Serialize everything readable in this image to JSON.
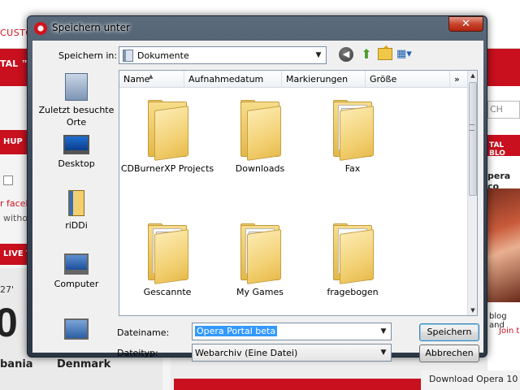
{
  "background": {
    "custo_text": "CUSTO",
    "portal_text": "TAL ™",
    "hup_text": "HUP",
    "live_text": "LIVE T",
    "facebook_text": "r faceb",
    "without_text": "withou",
    "minute_text": "27'",
    "score_digit": "0",
    "team_left": "bania",
    "team_right": "Denmark",
    "search_text": "CH",
    "right_banner_text": "TAL BLO",
    "opera_co_text": "pera co",
    "blog_text": "blog and",
    "join_text": "Join t",
    "download_text": "Download Opera 10"
  },
  "dialog": {
    "title": "Speichern unter",
    "close_label": "✕",
    "save_in_label": "Speichern in:",
    "save_in_value": "Dokumente",
    "columns": [
      {
        "label": "Name"
      },
      {
        "label": "Aufnahmedatum"
      },
      {
        "label": "Markierungen"
      },
      {
        "label": "Größe"
      },
      {
        "label": "»"
      }
    ],
    "places": [
      {
        "label": "Zuletzt besuchte Orte",
        "icon": "recent-places-icon"
      },
      {
        "label": "Desktop",
        "icon": "desktop-icon"
      },
      {
        "label": "riDDi",
        "icon": "user-folder-icon"
      },
      {
        "label": "Computer",
        "icon": "computer-icon"
      },
      {
        "label": "",
        "icon": "network-icon"
      }
    ],
    "items": [
      {
        "label": "CDBurnerXP Projects"
      },
      {
        "label": "Downloads"
      },
      {
        "label": "Fax"
      },
      {
        "label": "Gescannte"
      },
      {
        "label": "My Games"
      },
      {
        "label": "fragebogen"
      }
    ],
    "filename_label": "Dateiname:",
    "filename_value": "Opera Portal beta",
    "filetype_label": "Dateityp:",
    "filetype_value": "Webarchiv (Eine Datei)",
    "save_button": "Speichern",
    "cancel_button": "Abbrechen"
  }
}
